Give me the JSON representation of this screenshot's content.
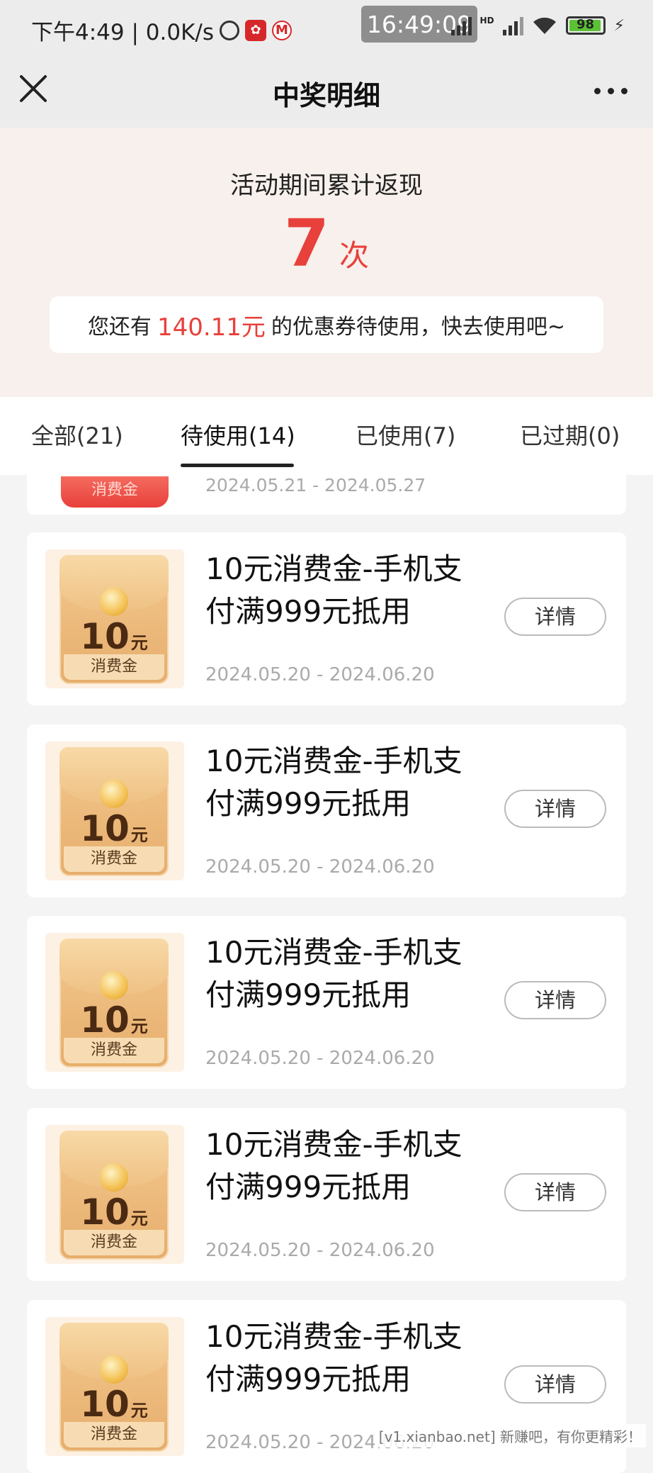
{
  "status_bar": {
    "left_text": "下午4:49 | 0.0K/s",
    "time_overlay": "16:49:09",
    "network_label": "HD",
    "battery": "98"
  },
  "nav": {
    "title": "中奖明细"
  },
  "summary": {
    "label": "活动期间累计返现",
    "count": "7",
    "count_unit": "次",
    "tip_prefix": "您还有",
    "tip_amount": "140.11元",
    "tip_suffix": "的优惠券待使用，快去使用吧~"
  },
  "tabs": [
    {
      "label": "全部(21)"
    },
    {
      "label": "待使用(14)",
      "active": true
    },
    {
      "label": "已使用(7)"
    },
    {
      "label": "已过期(0)"
    }
  ],
  "partial_card": {
    "badge": "消费金",
    "date": "2024.05.21 - 2024.05.27"
  },
  "coupons": [
    {
      "amount": "10",
      "unit": "元",
      "badge": "消费金",
      "title_line1": "10元消费金-手机支",
      "title_line2": "付满999元抵用",
      "date": "2024.05.20 - 2024.06.20",
      "button": "详情"
    },
    {
      "amount": "10",
      "unit": "元",
      "badge": "消费金",
      "title_line1": "10元消费金-手机支",
      "title_line2": "付满999元抵用",
      "date": "2024.05.20 - 2024.06.20",
      "button": "详情"
    },
    {
      "amount": "10",
      "unit": "元",
      "badge": "消费金",
      "title_line1": "10元消费金-手机支",
      "title_line2": "付满999元抵用",
      "date": "2024.05.20 - 2024.06.20",
      "button": "详情"
    },
    {
      "amount": "10",
      "unit": "元",
      "badge": "消费金",
      "title_line1": "10元消费金-手机支",
      "title_line2": "付满999元抵用",
      "date": "2024.05.20 - 2024.06.20",
      "button": "详情"
    },
    {
      "amount": "10",
      "unit": "元",
      "badge": "消费金",
      "title_line1": "10元消费金-手机支",
      "title_line2": "付满999元抵用",
      "date": "2024.05.20 - 2024.06.20",
      "button": "详情"
    }
  ],
  "watermark": "[v1.xianbao.net] 新赚吧，有你更精彩！",
  "colors": {
    "accent_red": "#e8403b",
    "summary_bg": "#f7f0ec",
    "page_bg": "#f4f4f4"
  },
  "icons": [
    "close-icon",
    "more-icon",
    "alarm-icon",
    "signal-icon",
    "wifi-icon",
    "battery-icon",
    "charging-icon"
  ]
}
